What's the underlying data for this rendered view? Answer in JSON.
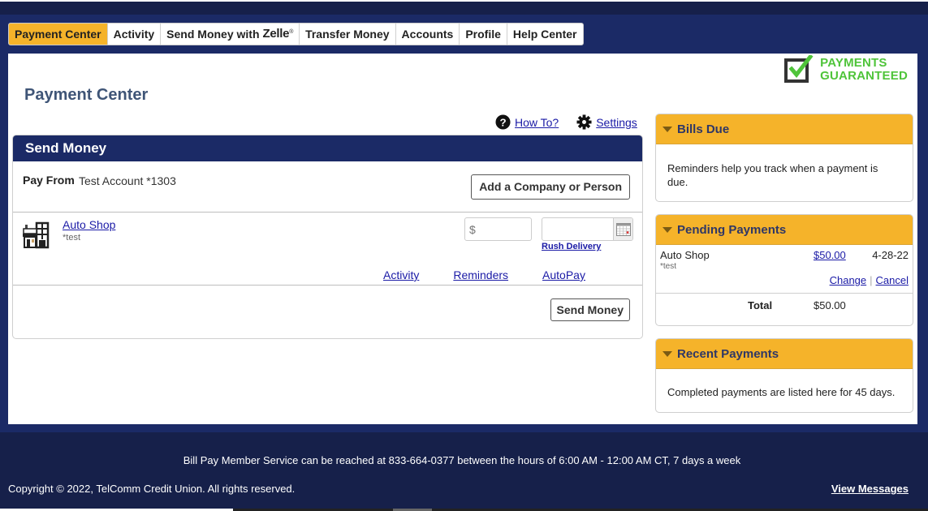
{
  "nav": {
    "tabs": [
      {
        "label": "Payment Center",
        "active": true
      },
      {
        "label": "Activity"
      },
      {
        "label": "Send Money with",
        "brand": "Zelle",
        "brand_mark": "®"
      },
      {
        "label": "Transfer Money"
      },
      {
        "label": "Accounts"
      },
      {
        "label": "Profile"
      },
      {
        "label": "Help Center"
      }
    ]
  },
  "badge": {
    "line1": "PAYMENTS",
    "line2": "GUARANTEED",
    "icon": "checkbox-check-icon",
    "color": "#4fc43a"
  },
  "page_title": "Payment Center",
  "help_links": {
    "how_to": "How To?",
    "settings": "Settings"
  },
  "send_money": {
    "title": "Send Money",
    "pay_from_label": "Pay From",
    "pay_from_value": "Test Account *1303",
    "add_button": "Add a Company or Person",
    "payee": {
      "name": "Auto Shop",
      "note": "*test",
      "amount_placeholder": "$",
      "date_value": "",
      "rush_delivery": "Rush Delivery",
      "links": [
        "Activity",
        "Reminders",
        "AutoPay"
      ]
    },
    "send_button": "Send Money"
  },
  "sidebar": {
    "bills_due": {
      "title": "Bills Due",
      "text": "Reminders help you track when a payment is due."
    },
    "pending": {
      "title": "Pending Payments",
      "items": [
        {
          "name": "Auto Shop",
          "note": "*test",
          "amount": "$50.00",
          "date": "4-28-22",
          "change": "Change",
          "cancel": "Cancel"
        }
      ],
      "total_label": "Total",
      "total_value": "$50.00"
    },
    "recent": {
      "title": "Recent Payments",
      "text": "Completed payments are listed here for 45 days."
    }
  },
  "footer": {
    "service": "Bill Pay Member Service can be reached at 833-664-0377 between the hours of 6:00 AM - 12:00 AM CT, 7 days a week",
    "copyright": "Copyright © 2022, TelComm Credit Union. All rights reserved.",
    "view_messages": "View Messages"
  },
  "colors": {
    "navy": "#1b2a66",
    "accent": "#f5b32a",
    "link": "#1a1aa6"
  }
}
